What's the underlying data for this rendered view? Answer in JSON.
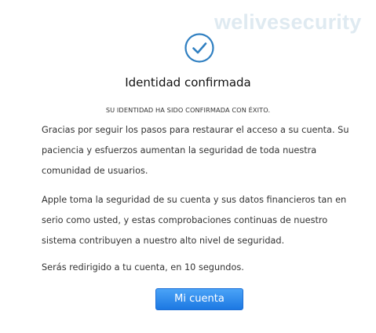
{
  "watermark": {
    "text": "welivesecurity"
  },
  "status_icon": "check-circle-icon",
  "title": "Identidad confirmada",
  "subtitle": "SU IDENTIDAD HA SIDO CONFIRMADA CON ÉXITO.",
  "paragraphs": [
    "Gracias por seguir los pasos para restaurar el acceso a su cuenta. Su paciencia y esfuerzos aumentan la seguridad de toda nuestra comunidad de usuarios.",
    "Apple toma la seguridad de su cuenta y sus datos financieros tan en serio como usted, y estas comprobaciones continuas de nuestro sistema contribuyen a nuestro alto nivel de seguridad.",
    "Serás redirigido a tu cuenta, en 10 segundos."
  ],
  "button": {
    "label": "Mi cuenta"
  },
  "colors": {
    "accent": "#2f7fc1",
    "button_top": "#4aa3f7",
    "button_bottom": "#1c78e2",
    "watermark": "#dfeaf1"
  }
}
